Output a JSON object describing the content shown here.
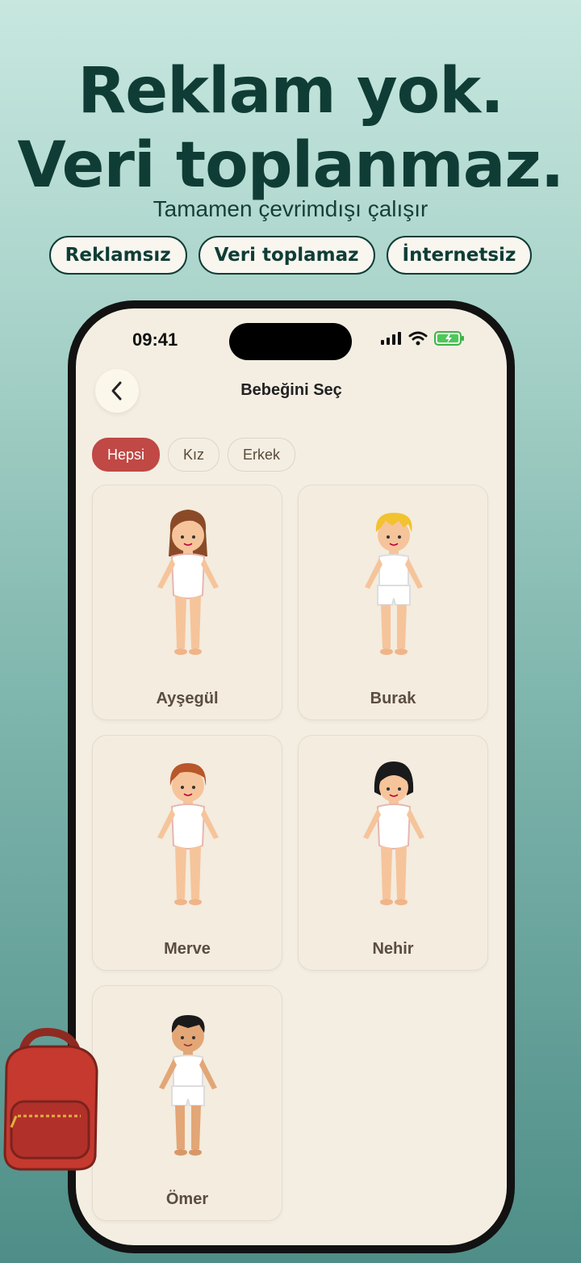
{
  "headline": {
    "line1": "Reklam yok.",
    "line2": "Veri toplanmaz.",
    "subtitle": "Tamamen çevrimdışı çalışır"
  },
  "badges": [
    "Reklamsız",
    "Veri toplamaz",
    "İnternetsiz"
  ],
  "status_bar": {
    "time": "09:41"
  },
  "nav": {
    "title": "Bebeğini Seç"
  },
  "filters": [
    {
      "label": "Hepsi",
      "active": true
    },
    {
      "label": "Kız",
      "active": false
    },
    {
      "label": "Erkek",
      "active": false
    }
  ],
  "dolls": [
    {
      "name": "Ayşegül"
    },
    {
      "name": "Burak"
    },
    {
      "name": "Merve"
    },
    {
      "name": "Nehir"
    },
    {
      "name": "Ömer"
    }
  ],
  "colors": {
    "accent": "#c04845",
    "headline": "#0f3d36",
    "screen_bg": "#f4eee2"
  }
}
